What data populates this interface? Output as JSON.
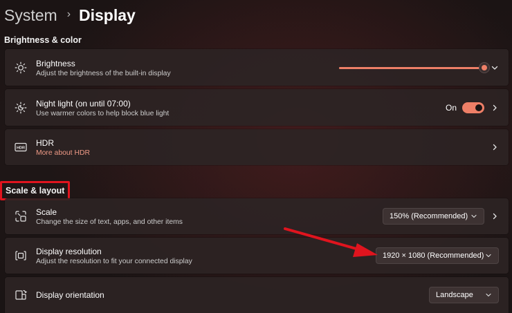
{
  "breadcrumb": {
    "parent": "System",
    "separator": "›",
    "current": "Display"
  },
  "sections": {
    "brightness_color": "Brightness & color",
    "scale_layout": "Scale & layout"
  },
  "brightness": {
    "title": "Brightness",
    "subtitle": "Adjust the brightness of the built-in display",
    "level": 1.0,
    "icon": "sun-icon"
  },
  "night_light": {
    "title": "Night light (on until 07:00)",
    "subtitle": "Use warmer colors to help block blue light",
    "toggle_label": "On",
    "toggle_on": true,
    "icon": "night-light-icon"
  },
  "hdr": {
    "title": "HDR",
    "link": "More about HDR",
    "icon": "hdr-icon"
  },
  "scale": {
    "title": "Scale",
    "subtitle": "Change the size of text, apps, and other items",
    "value": "150% (Recommended)",
    "icon": "scale-icon"
  },
  "resolution": {
    "title": "Display resolution",
    "subtitle": "Adjust the resolution to fit your connected display",
    "value": "1920 × 1080 (Recommended)",
    "icon": "resolution-icon"
  },
  "orientation": {
    "title": "Display orientation",
    "value": "Landscape",
    "icon": "orientation-icon"
  },
  "colors": {
    "accent": "#ee7f67",
    "link": "#ef9a86",
    "annotation": "#e0141e",
    "card": "#2c2424"
  }
}
